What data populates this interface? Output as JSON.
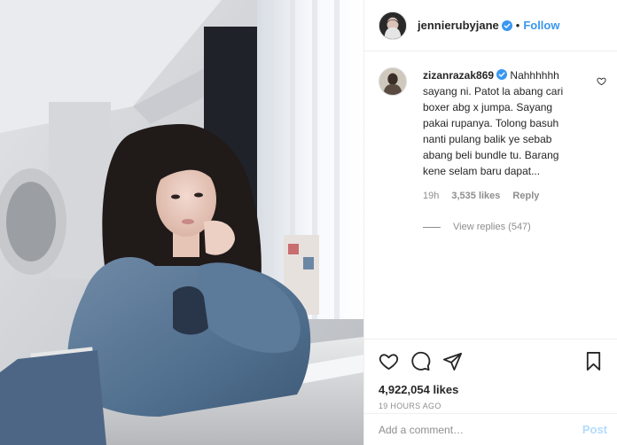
{
  "post": {
    "author": {
      "username": "jennierubyjane",
      "verified": true,
      "follow_label": "Follow",
      "separator": "•"
    },
    "photo_description_icon": "photo",
    "comment": {
      "username": "zizanrazak869",
      "verified": true,
      "text": "Nahhhhhh sayang ni. Patot la abang cari boxer abg x jumpa. Sayang pakai rupanya. Tolong basuh nanti pulang balik ye sebab abang beli bundle tu. Barang kene selam baru dapat...",
      "age": "19h",
      "likes": "3,535 likes",
      "reply_label": "Reply",
      "view_replies": "View replies (547)"
    },
    "likes": "4,922,054 likes",
    "timestamp": "19 HOURS AGO",
    "add_comment": {
      "placeholder": "Add a comment…",
      "post_label": "Post"
    },
    "icons": [
      "heart-icon",
      "comment-icon",
      "share-icon",
      "bookmark-icon"
    ],
    "colors": {
      "accent": "#3897f0",
      "verified": "#3897f0",
      "text": "#262626",
      "muted": "#8e8e8e",
      "post_disabled": "#b3dbff",
      "border": "#efefef"
    }
  }
}
